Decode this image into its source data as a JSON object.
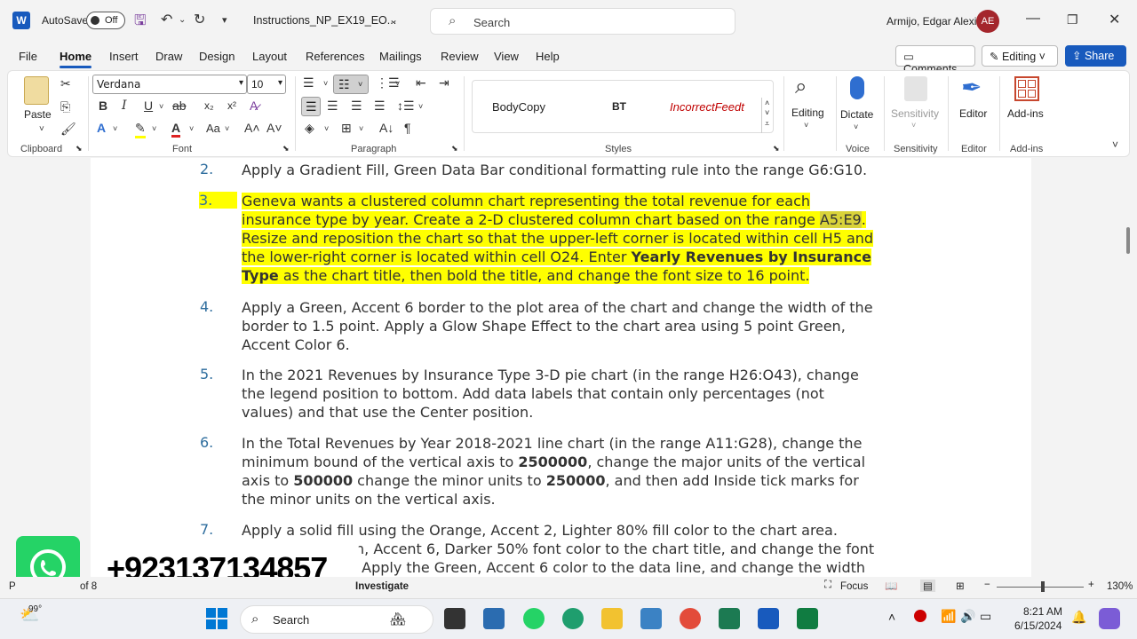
{
  "titlebar": {
    "app_logo": "W",
    "autosave_label": "AutoSave",
    "autosave_state": "Off",
    "doc_title": "Instructions_NP_EX19_EO...",
    "search_placeholder": "Search",
    "user_name": "Armijo, Edgar Alexis",
    "user_initials": "AE"
  },
  "menu": {
    "items": [
      "File",
      "Home",
      "Insert",
      "Draw",
      "Design",
      "Layout",
      "References",
      "Mailings",
      "Review",
      "View",
      "Help"
    ],
    "active": "Home",
    "comments_label": "Comments",
    "editing_label": "Editing",
    "share_label": "Share"
  },
  "ribbon": {
    "clipboard": {
      "paste_label": "Paste",
      "group_label": "Clipboard"
    },
    "font": {
      "font_name": "Verdana",
      "font_size": "10",
      "group_label": "Font",
      "case_label": "Aa"
    },
    "paragraph": {
      "group_label": "Paragraph"
    },
    "styles": {
      "items": [
        "BodyCopy",
        "BT",
        "IncorrectFeedt"
      ],
      "group_label": "Styles"
    },
    "editing": {
      "label": "Editing"
    },
    "voice": {
      "dictate_label": "Dictate",
      "group_label": "Voice"
    },
    "sensitivity": {
      "label": "Sensitivity",
      "group_label": "Sensitivity"
    },
    "editor": {
      "label": "Editor",
      "group_label": "Editor"
    },
    "addins": {
      "label": "Add-ins",
      "group_label": "Add-ins"
    }
  },
  "document": {
    "items": [
      {
        "num": "2.",
        "lines": [
          "Apply a Gradient Fill, Green Data Bar conditional formatting rule into the range G6:G10."
        ]
      },
      {
        "num": "3.",
        "line1": "Geneva wants a clustered column chart representing the total revenue for each",
        "line2a": "insurance type by year. Create a 2-D clustered column chart based on the range ",
        "line2b": "A5:E9",
        "line2c": ".",
        "line3": "Resize and reposition the chart so that the upper-left corner is located within cell H5 and",
        "line4a": "the lower-right corner is located within cell O24. Enter ",
        "line4b": "Yearly Revenues by Insurance",
        "line5a": "Type",
        "line5b": " as the chart title, then bold the title, and change the font size to 16 point."
      },
      {
        "num": "4.",
        "lines": [
          "Apply a Green, Accent 6 border to the plot area of the chart and change the width of the",
          "border to 1.5 point. Apply a Glow Shape Effect to the chart area using 5 point Green,",
          "Accent Color 6."
        ]
      },
      {
        "num": "5.",
        "lines": [
          "In the 2021 Revenues by Insurance Type 3-D pie chart (in the range H26:O43), change",
          "the legend position to bottom. Add data labels that contain only percentages (not",
          "values) and that use the Center position."
        ]
      },
      {
        "num": "6.",
        "line1": "In the Total Revenues by Year 2018-2021 line chart (in the range A11:G28), change the",
        "line2a": "minimum bound of the vertical axis to ",
        "line2b": "2500000",
        "line2c": ", change the major units of the vertical",
        "line3a": "axis to ",
        "line3b": "500000",
        "line3c": " change the minor units to ",
        "line3d": "250000",
        "line3e": ", and then add Inside tick marks for",
        "line4": "the minor units on the vertical axis."
      },
      {
        "num": "7.",
        "lines": [
          "Apply a solid fill using the Orange, Accent 2, Lighter 80% fill color to the chart area.",
          "n, Accent 6, Darker 50% font color to the chart title, and change the font",
          ". Apply the Green, Accent 6 color to the data line, and change the width"
        ]
      }
    ]
  },
  "overlay": {
    "phone": "+923137134857"
  },
  "statusbar": {
    "left_text_a": "P",
    "left_text_b": "of 8",
    "investigate": "Investigate",
    "focus_label": "Focus",
    "zoom": "130%"
  },
  "taskbar": {
    "weather": "99°",
    "search_placeholder": "Search",
    "time": "8:21 AM",
    "date": "6/15/2024"
  }
}
